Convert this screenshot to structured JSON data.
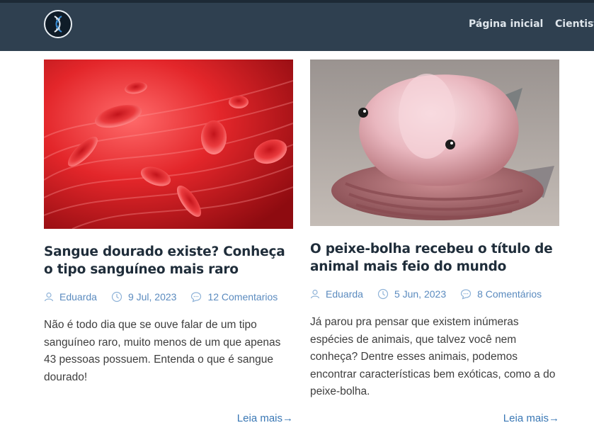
{
  "nav": {
    "logo_icon": "dna-helix-icon",
    "links": [
      {
        "label": "Página inicial"
      },
      {
        "label": "Cientist"
      }
    ]
  },
  "colors": {
    "navbar": "#2f4050",
    "title": "#1f2d3a",
    "meta": "#5b8bbf",
    "link": "#3a78b5"
  },
  "posts": [
    {
      "image": "red-blood-cells-image",
      "title": "Sangue dourado existe? Conheça o tipo sanguíneo mais raro",
      "author": "Eduarda",
      "date": "9 Jul, 2023",
      "comments": "12 Comentarios",
      "excerpt": "Não é todo dia que se ouve falar de um tipo sanguíneo raro, muito menos de um que apenas 43 pessoas possuem. Entenda o que é sangue dourado!",
      "more": "Leia mais→"
    },
    {
      "image": "blobfish-image",
      "title": "O peixe-bolha recebeu o título de animal mais feio do mundo",
      "author": "Eduarda",
      "date": "5 Jun, 2023",
      "comments": "8 Comentários",
      "excerpt": "Já parou pra pensar que existem inúmeras espécies de animais, que talvez você nem conheça? Dentre esses animais, podemos encontrar características bem exóticas, como a do peixe-bolha.",
      "more": "Leia mais→"
    }
  ]
}
